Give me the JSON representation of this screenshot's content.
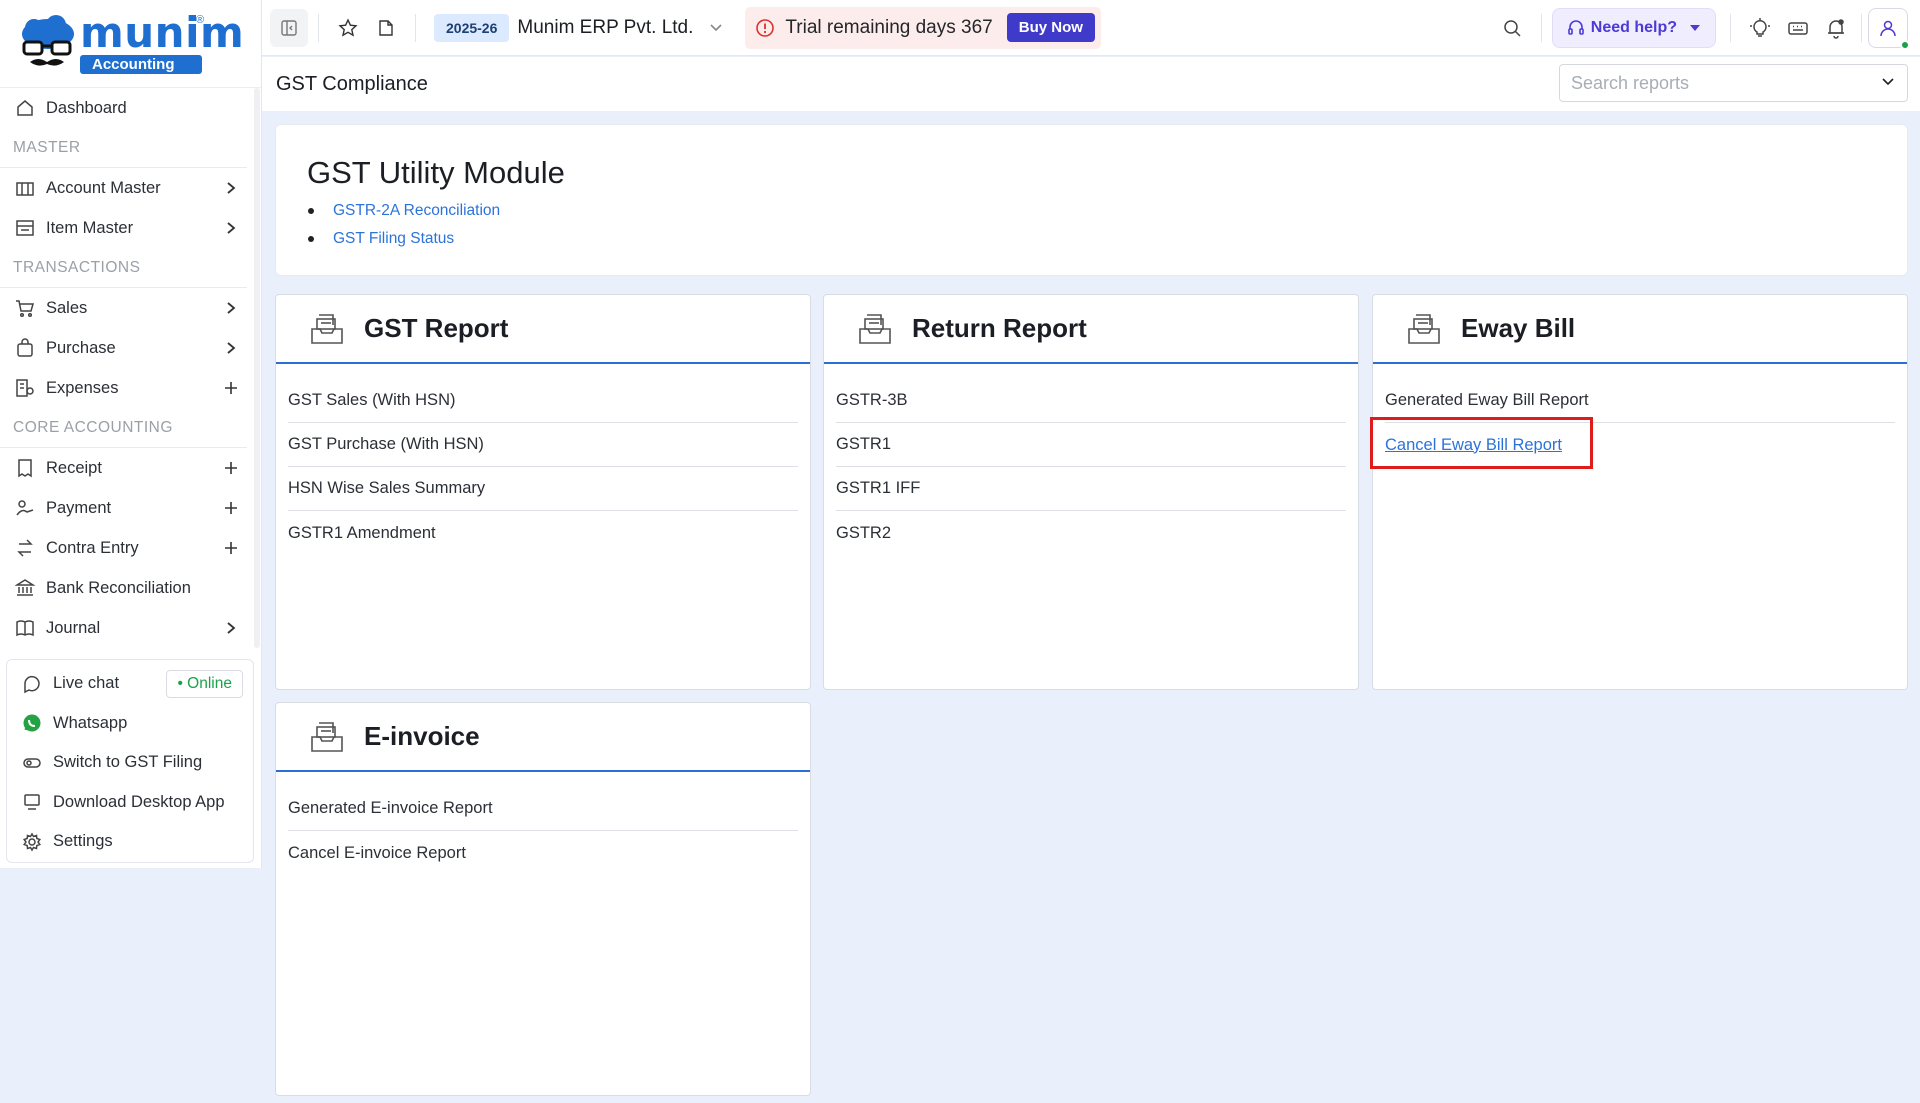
{
  "brand": {
    "name": "munim",
    "sub": "Accounting",
    "reg": "®"
  },
  "sidebar": {
    "items": [
      {
        "label": "Dashboard",
        "icon": "home-icon",
        "right": ""
      },
      {
        "section": "MASTER"
      },
      {
        "label": "Account Master",
        "icon": "building-icon",
        "right": "chevron-right"
      },
      {
        "label": "Item Master",
        "icon": "item-box-icon",
        "right": "chevron-right"
      },
      {
        "section": "TRANSACTIONS"
      },
      {
        "label": "Sales",
        "icon": "cart-icon",
        "right": "chevron-right"
      },
      {
        "label": "Purchase",
        "icon": "bag-icon",
        "right": "chevron-right"
      },
      {
        "label": "Expenses",
        "icon": "expenses-icon",
        "right": "plus"
      },
      {
        "section": "CORE ACCOUNTING"
      },
      {
        "label": "Receipt",
        "icon": "receipt-icon",
        "right": "plus"
      },
      {
        "label": "Payment",
        "icon": "payment-icon",
        "right": "plus"
      },
      {
        "label": "Contra Entry",
        "icon": "contra-icon",
        "right": "plus"
      },
      {
        "label": "Bank Reconciliation",
        "icon": "bank-icon",
        "right": ""
      },
      {
        "label": "Journal",
        "icon": "book-icon",
        "right": "chevron-right"
      }
    ],
    "bottom": {
      "live_chat": "Live chat",
      "online": "• Online",
      "whatsapp": "Whatsapp",
      "switch_gst": "Switch to GST Filing",
      "download_app": "Download Desktop App",
      "settings": "Settings"
    }
  },
  "topbar": {
    "fy": "2025-26",
    "company": "Munim ERP Pvt. Ltd.",
    "trial": "Trial remaining days 367",
    "buy_now": "Buy Now",
    "need_help": "Need help?"
  },
  "subheader": {
    "title": "GST Compliance",
    "search_placeholder": "Search reports"
  },
  "utility": {
    "title": "GST Utility Module",
    "links": [
      "GSTR-2A Reconciliation",
      "GST Filing Status"
    ]
  },
  "cards": {
    "gst_report": {
      "title": "GST Report",
      "rows": [
        "GST Sales (With HSN)",
        "GST Purchase (With HSN)",
        "HSN Wise Sales Summary",
        "GSTR1 Amendment"
      ]
    },
    "return_report": {
      "title": "Return Report",
      "rows": [
        "GSTR-3B",
        "GSTR1",
        "GSTR1 IFF",
        "GSTR2"
      ]
    },
    "eway_bill": {
      "title": "Eway Bill",
      "rows": [
        "Generated Eway Bill Report",
        "Cancel Eway Bill Report"
      ]
    },
    "einvoice": {
      "title": "E-invoice",
      "rows": [
        "Generated E-invoice Report",
        "Cancel E-invoice Report"
      ]
    }
  },
  "colors": {
    "accent": "#2b6fd6",
    "link": "#2c73d9",
    "highlight": "#e01b1b",
    "buy": "#3f3ac9",
    "online": "#19a24a"
  }
}
